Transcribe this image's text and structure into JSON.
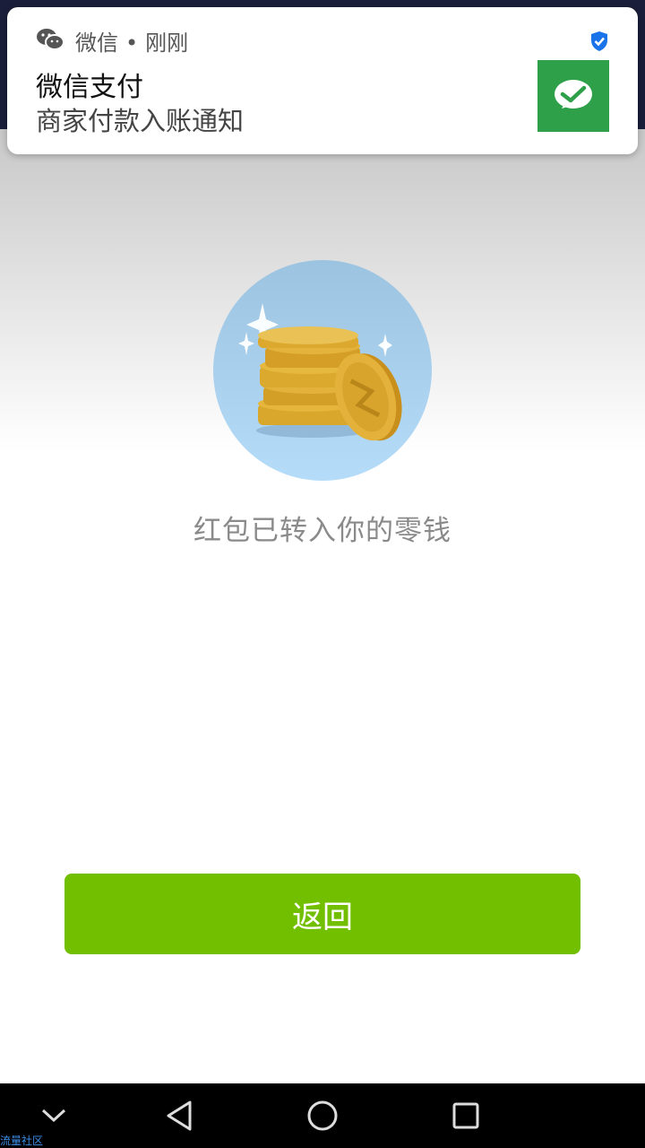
{
  "notification": {
    "app_name": "微信",
    "separator": "•",
    "time": "刚刚",
    "title": "微信支付",
    "body": "商家付款入账通知",
    "icons": {
      "app": "wechat-icon",
      "verified": "shield-check-icon",
      "thumbnail": "wechat-pay-icon"
    },
    "thumbnail_color": "#2fa04a"
  },
  "main": {
    "illustration": "coins-stack-icon",
    "message": "红包已转入你的零钱",
    "back_button_label": "返回",
    "accent_color": "#72bf00"
  },
  "nav_bar": {
    "items": [
      "collapse-icon",
      "back-icon",
      "home-icon",
      "recents-icon"
    ]
  },
  "watermark": "流量社区"
}
